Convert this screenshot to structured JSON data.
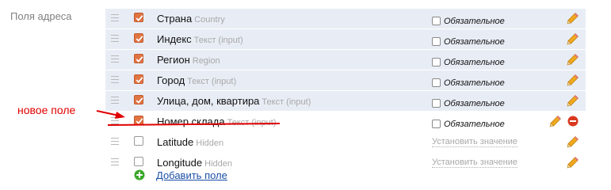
{
  "section": {
    "label": "Поля адреса"
  },
  "rows": [
    {
      "name": "Страна",
      "type": "Country",
      "checked": true,
      "shaded": true,
      "mode": "required",
      "required_label": "Обязательное",
      "icons": [
        "pencil-icon"
      ]
    },
    {
      "name": "Индекс",
      "type": "Текст (input)",
      "checked": true,
      "shaded": true,
      "mode": "required",
      "required_label": "Обязательное",
      "icons": [
        "pencil-icon"
      ]
    },
    {
      "name": "Регион",
      "type": "Region",
      "checked": true,
      "shaded": true,
      "mode": "required",
      "required_label": "Обязательное",
      "icons": [
        "pencil-icon"
      ]
    },
    {
      "name": "Город",
      "type": "Текст (input)",
      "checked": true,
      "shaded": true,
      "mode": "required",
      "required_label": "Обязательное",
      "icons": [
        "pencil-icon"
      ]
    },
    {
      "name": "Улица, дом, квартира",
      "type": "Текст (input)",
      "checked": true,
      "shaded": true,
      "mode": "required",
      "required_label": "Обязательное",
      "icons": [
        "pencil-icon"
      ]
    },
    {
      "name": "Номер склада",
      "type": "Текст (input)",
      "checked": true,
      "shaded": false,
      "mode": "required",
      "required_label": "Обязательное",
      "icons": [
        "pencil-icon",
        "remove-icon"
      ]
    },
    {
      "name": "Latitude",
      "type": "Hidden",
      "checked": false,
      "shaded": false,
      "mode": "value",
      "value_link": "Установить значение",
      "icons": [
        "pencil-icon"
      ]
    },
    {
      "name": "Longitude",
      "type": "Hidden",
      "checked": false,
      "shaded": false,
      "mode": "value",
      "value_link": "Установить значение",
      "icons": [
        "pencil-icon"
      ]
    }
  ],
  "add_field": {
    "label": "Добавить поле",
    "icon": "plus-circle-icon"
  },
  "annotation": {
    "text": "новое поле",
    "color": "#e00000"
  },
  "colors": {
    "row_shade": "#e8edf5",
    "checkbox_checked": "#e07443",
    "link": "#1a4fa6",
    "pencil": "#f0a81e",
    "remove": "#d9381e",
    "add": "#3aa829",
    "annotation": "#e00000"
  }
}
